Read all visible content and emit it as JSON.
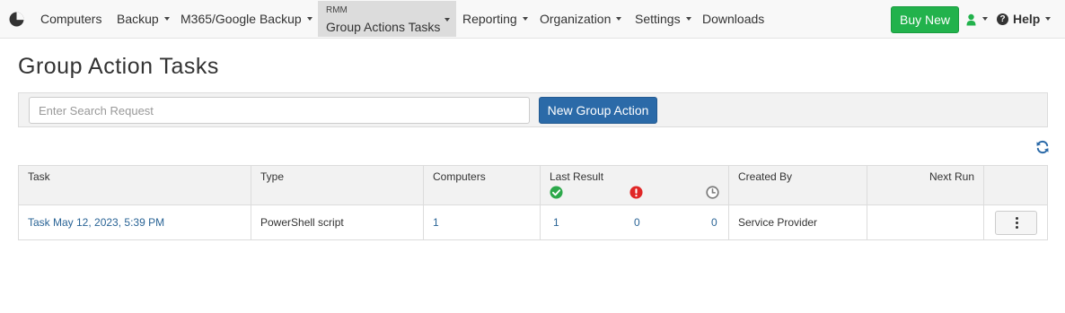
{
  "nav": {
    "logo_icon": "pie-chart-icon",
    "items": [
      {
        "label": "Computers",
        "has_caret": false
      },
      {
        "label": "Backup",
        "has_caret": true
      },
      {
        "label": "M365/Google Backup",
        "has_caret": true
      },
      {
        "label": "Reporting",
        "has_caret": true
      },
      {
        "label": "Organization",
        "has_caret": true
      },
      {
        "label": "Settings",
        "has_caret": true
      },
      {
        "label": "Downloads",
        "has_caret": false
      }
    ],
    "rmm": {
      "small": "RMM",
      "label": "Group Actions Tasks"
    },
    "buy_new": "Buy New",
    "user_icon": "user-icon",
    "help": "Help"
  },
  "page": {
    "title": "Group Action Tasks",
    "search_placeholder": "Enter Search Request",
    "new_group_action": "New Group Action",
    "refresh_icon": "refresh-icon"
  },
  "table": {
    "headers": {
      "task": "Task",
      "type": "Type",
      "computers": "Computers",
      "last_result": "Last Result",
      "created_by": "Created By",
      "next_run": "Next Run"
    },
    "status_icons": [
      "success-check-icon",
      "error-exclamation-icon",
      "pending-clock-icon"
    ],
    "rows": [
      {
        "task": "Task May 12, 2023, 5:39 PM",
        "type": "PowerShell script",
        "computers": "1",
        "success": "1",
        "error": "0",
        "pending": "0",
        "created_by": "Service Provider",
        "next_run": ""
      }
    ]
  },
  "colors": {
    "accent_green": "#22b24c",
    "accent_blue": "#2b6aa8",
    "success": "#2ca84a",
    "error": "#e02727",
    "pending": "#7a7a7a"
  }
}
